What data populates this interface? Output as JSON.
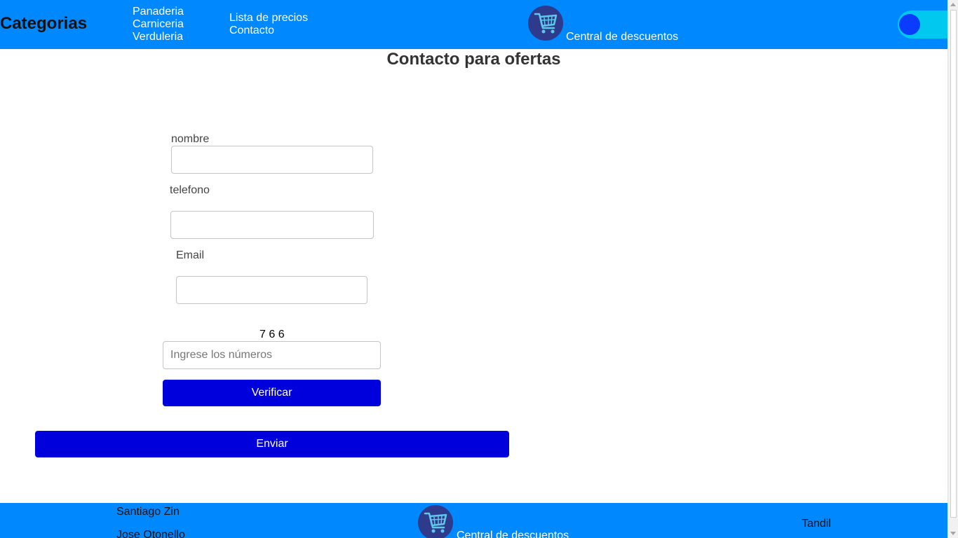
{
  "header": {
    "brand": "Categorias",
    "nav_col1": [
      "Panaderia",
      "Carniceria",
      "Verduleria"
    ],
    "nav_col2": [
      "Lista de precios",
      "Contacto"
    ],
    "logo_icon": "shopping-cart-icon",
    "logo_text": "Central de descuentos",
    "toggle_state": "off"
  },
  "main": {
    "title": "Contacto para ofertas",
    "form": {
      "nombre_label": "nombre",
      "nombre_value": "",
      "telefono_label": "telefono",
      "telefono_value": "",
      "email_label": "Email",
      "email_value": "",
      "captcha_text": "7 6 6",
      "captcha_placeholder": "Ingrese los números",
      "verify_label": "Verificar",
      "submit_label": "Enviar"
    }
  },
  "footer": {
    "authors": [
      "Santiago Zin",
      "Jose Otonello"
    ],
    "logo_text": "Central de descuentos",
    "city": "Tandil"
  },
  "colors": {
    "header_bg": "#0088ff",
    "button_bg": "#0000dd",
    "toggle_track": "#00c8ee",
    "toggle_knob": "#0a3cff",
    "logo_bg": "#2e3a8c"
  }
}
